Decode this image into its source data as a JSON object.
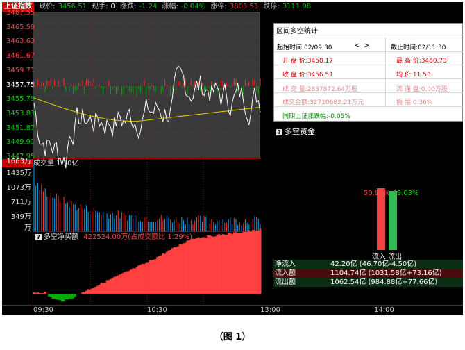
{
  "topbar": {
    "index_name": "上证指数",
    "price_label": "现价:",
    "price": "3456.51",
    "hand_label": "现手:",
    "hand": "0",
    "change_label": "涨跌:",
    "change": "-1.24",
    "pct_label": "涨幅:",
    "pct": "-0.04%",
    "limit_up_label": "涨停:",
    "limit_up": "3803.53",
    "limit_down_label": "跌停:",
    "limit_down": "3111.98"
  },
  "price_axis": [
    "3467.55",
    "3465.59",
    "3463.63",
    "3461.67",
    "3459.71",
    "3457.75",
    "3455.79",
    "3453.83",
    "3451.87",
    "3449.91",
    "3447.95"
  ],
  "volume": {
    "title": "成交量 1.10亿",
    "axis": [
      "1663万",
      "1435万",
      "1073万",
      "711万",
      "349万",
      "万"
    ]
  },
  "netbuy": {
    "title": "多空净买额",
    "value": "422524.00万(占成交额比 1.29%)"
  },
  "time_axis": [
    "09:30",
    "10:30",
    "13:00",
    "14:00"
  ],
  "stats": {
    "title": "区间多空统计",
    "start_label": "起始时间:02/09:30",
    "end_label": "截止时间:02/11:30",
    "nav_prev": "<",
    "nav_next": ">",
    "open": "开 盘 价:3458.17",
    "high": "最 高 价:3460.73",
    "close": "收 盘 价:3456.51",
    "avg": "均    价:11.53",
    "volume": "成 交 量:2837872.64万股",
    "float": "流 通 盘:0.00万股",
    "amount": "成交金额:32710682.21万元",
    "amplitude": "振    幅:0.36%",
    "period_change": "同期上证涨跌幅:-0.05%"
  },
  "flow": {
    "title": "多空资金",
    "in_pct": "50.97%",
    "out_pct": "49.03%",
    "in_label": "流入",
    "out_label": "流出",
    "net_label": "净流入",
    "net_value": "42.20亿 (46.70亿-4.50亿)",
    "inflow_label": "流入额",
    "inflow_value": "1104.74亿 (1031.58亿+73.16亿)",
    "outflow_label": "流出额",
    "outflow_value": "1062.54亿 (984.88亿+77.66亿)"
  },
  "caption": "（图 1）",
  "colors": {
    "up": "#ff4040",
    "down": "#00d000",
    "avg_line": "#e6d300",
    "price_line": "#ffffff"
  }
}
